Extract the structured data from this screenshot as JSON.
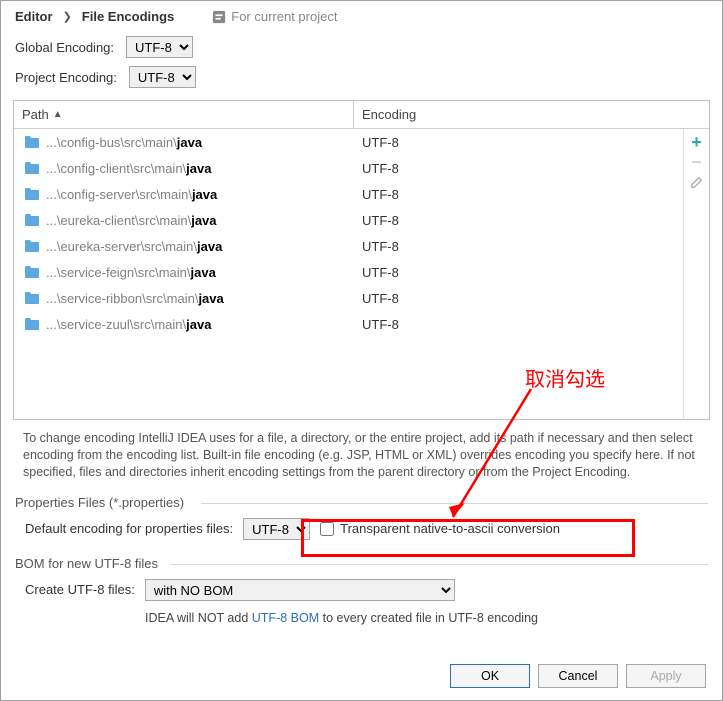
{
  "breadcrumb": {
    "editor": "Editor",
    "page": "File Encodings",
    "context": "For current project"
  },
  "globalEnc": {
    "label": "Global Encoding:",
    "value": "UTF-8"
  },
  "projectEnc": {
    "label": "Project Encoding:",
    "value": "UTF-8"
  },
  "table": {
    "head": {
      "path": "Path",
      "encoding": "Encoding"
    },
    "rows": [
      {
        "pre": "...\\config-bus\\src\\main\\",
        "leaf": "java",
        "enc": "UTF-8"
      },
      {
        "pre": "...\\config-client\\src\\main\\",
        "leaf": "java",
        "enc": "UTF-8"
      },
      {
        "pre": "...\\config-server\\src\\main\\",
        "leaf": "java",
        "enc": "UTF-8"
      },
      {
        "pre": "...\\eureka-client\\src\\main\\",
        "leaf": "java",
        "enc": "UTF-8"
      },
      {
        "pre": "...\\eureka-server\\src\\main\\",
        "leaf": "java",
        "enc": "UTF-8"
      },
      {
        "pre": "...\\service-feign\\src\\main\\",
        "leaf": "java",
        "enc": "UTF-8"
      },
      {
        "pre": "...\\service-ribbon\\src\\main\\",
        "leaf": "java",
        "enc": "UTF-8"
      },
      {
        "pre": "...\\service-zuul\\src\\main\\",
        "leaf": "java",
        "enc": "UTF-8"
      }
    ]
  },
  "help": "To change encoding IntelliJ IDEA uses for a file, a directory, or the entire project, add its path if necessary and then select encoding from the encoding list. Built-in file encoding (e.g. JSP, HTML or XML) overrides encoding you specify here. If not specified, files and directories inherit encoding settings from the parent directory or from the Project Encoding.",
  "sections": {
    "props": "Properties Files (*.properties)",
    "bom": "BOM for new UTF-8 files"
  },
  "props": {
    "defaultLabel": "Default encoding for properties files:",
    "defaultValue": "UTF-8",
    "transparent": "Transparent native-to-ascii conversion"
  },
  "bom": {
    "createLabel": "Create UTF-8 files:",
    "createValue": "with NO BOM",
    "help_pre": "IDEA will NOT add ",
    "help_link": "UTF-8 BOM",
    "help_post": " to every created file in UTF-8 encoding"
  },
  "annotation": "取消勾选",
  "buttons": {
    "ok": "OK",
    "cancel": "Cancel",
    "apply": "Apply"
  }
}
